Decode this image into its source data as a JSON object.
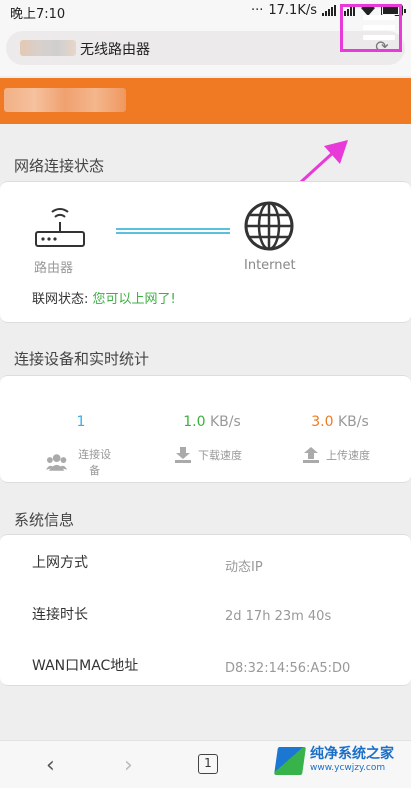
{
  "status_bar": {
    "time": "晚上7:10",
    "dots": "···",
    "speed": "17.1K/s"
  },
  "browser": {
    "title": "无线路由器",
    "tab_count": "1"
  },
  "sections": {
    "network": {
      "title": "网络连接状态",
      "router_label": "路由器",
      "internet_label": "Internet",
      "status_label": "联网状态:",
      "status_value": "您可以上网了!"
    },
    "stats": {
      "title": "连接设备和实时统计",
      "devices": {
        "value": "1",
        "label": "连接设备"
      },
      "download": {
        "value": "1.0",
        "unit": "KB/s",
        "label": "下载速度"
      },
      "upload": {
        "value": "3.0",
        "unit": "KB/s",
        "label": "上传速度"
      }
    },
    "system": {
      "title": "系统信息",
      "rows": [
        {
          "label": "上网方式",
          "value": "动态IP"
        },
        {
          "label": "连接时长",
          "value": "2d 17h 23m 40s"
        },
        {
          "label": "WAN口MAC地址",
          "value": "D8:32:14:56:A5:D0"
        }
      ]
    }
  },
  "watermark": {
    "title": "纯净系统之家",
    "url": "www.ycwjzy.com"
  },
  "colors": {
    "header": "#f07a23",
    "highlight": "#e83ad9",
    "devices": "#3aaee0",
    "download": "#3cb043",
    "upload": "#f07a23"
  },
  "icons": [
    "reload-icon",
    "menu-icon",
    "router-icon",
    "globe-icon",
    "users-icon",
    "download-icon",
    "upload-icon",
    "back-icon",
    "forward-icon"
  ]
}
